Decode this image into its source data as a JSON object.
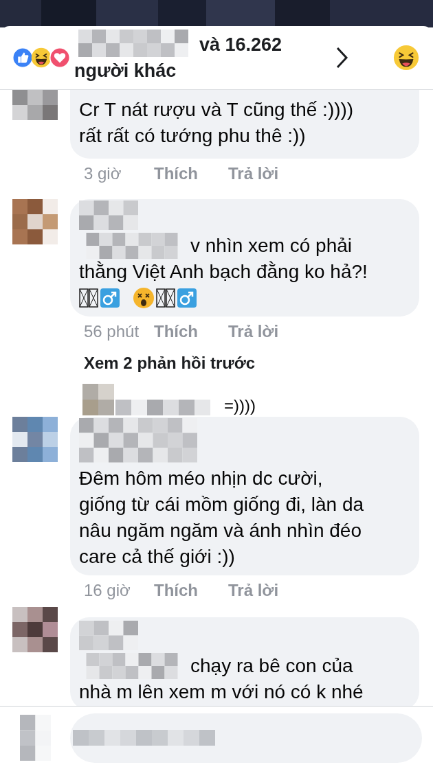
{
  "reactions_bar": {
    "summary": "và 16.262 người khác"
  },
  "comments": [
    {
      "kind": "comment",
      "text_lines": [
        "Cr T nát rượu và T cũng thế :))))",
        "rất rất có tướng phu thê :))"
      ],
      "name_inline": false,
      "name_hidden": true,
      "emoji_line": false,
      "time": "3 giờ",
      "like": "Thích",
      "reply": "Trả lời"
    },
    {
      "kind": "comment",
      "text_lines": [
        "v nhìn xem có phải",
        "thằng Việt Anh bạch đằng ko hả?!"
      ],
      "name_inline": true,
      "name_hidden": false,
      "emoji_line": true,
      "time": "56 phút",
      "like": "Thích",
      "reply": "Trả lời"
    },
    {
      "kind": "more_replies",
      "text": "Xem 2 phản hồi trước"
    },
    {
      "kind": "reply",
      "text": "=))))"
    },
    {
      "kind": "comment",
      "text_lines": [
        "Đêm hôm méo nhịn dc cười,",
        "giống từ cái mồm giống đi, làn da",
        "nâu ngăm ngăm và ánh nhìn đéo",
        "care cả thế giới :))"
      ],
      "name_inline": false,
      "name_hidden": false,
      "emoji_line": false,
      "time": "16 giờ",
      "like": "Thích",
      "reply": "Trả lời"
    },
    {
      "kind": "comment",
      "text_lines": [
        "chạy ra bê con của",
        "nhà m lên xem m với nó có k nhé"
      ],
      "name_inline": true,
      "name_hidden": false,
      "emoji_line": false
    }
  ],
  "composer": {
    "kind": "comment_field"
  }
}
